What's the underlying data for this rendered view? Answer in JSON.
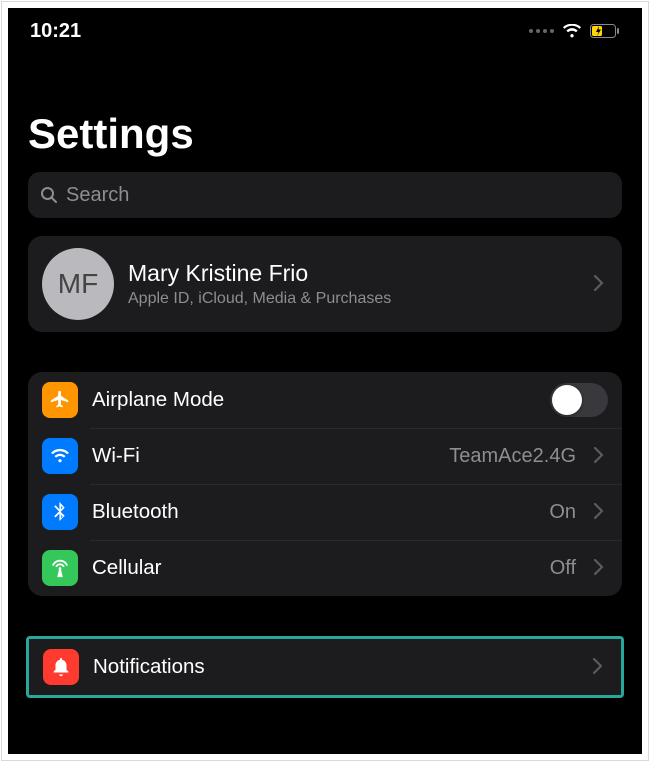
{
  "statusbar": {
    "time": "10:21"
  },
  "page": {
    "title": "Settings"
  },
  "search": {
    "placeholder": "Search"
  },
  "account": {
    "initials": "MF",
    "name": "Mary Kristine Frio",
    "subtitle": "Apple ID, iCloud, Media & Purchases"
  },
  "rows": {
    "airplane": {
      "label": "Airplane Mode",
      "enabled": false
    },
    "wifi": {
      "label": "Wi-Fi",
      "value": "TeamAce2.4G"
    },
    "bluetooth": {
      "label": "Bluetooth",
      "value": "On"
    },
    "cellular": {
      "label": "Cellular",
      "value": "Off"
    },
    "notifications": {
      "label": "Notifications"
    }
  },
  "colors": {
    "orange": "#ff9500",
    "blue": "#007aff",
    "green": "#34c759",
    "red": "#ff3b30",
    "highlight": "#2aa79b"
  }
}
